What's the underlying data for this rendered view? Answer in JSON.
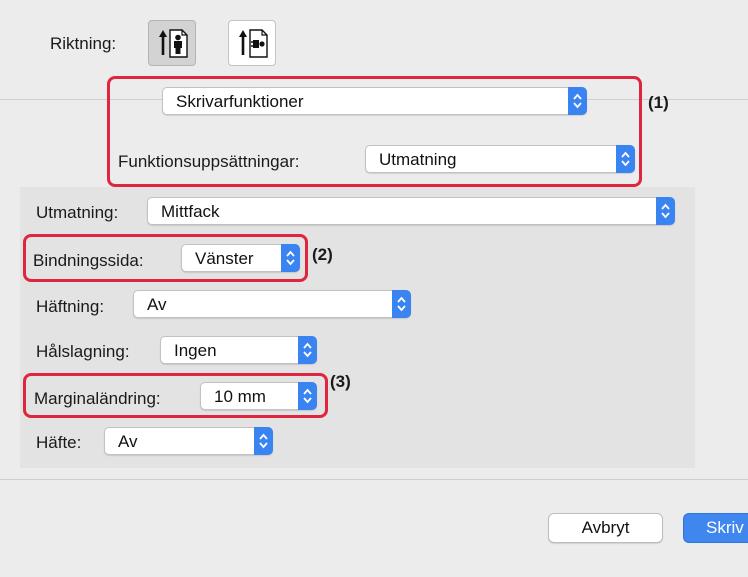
{
  "orientation": {
    "label": "Riktning:",
    "portrait_icon": "portrait-orientation-icon",
    "landscape_icon": "landscape-orientation-icon",
    "selected": "portrait"
  },
  "settings": {
    "category_value": "Skrivarfunktioner",
    "feature_set_label": "Funktionsuppsättningar:",
    "feature_set_value": "Utmatning"
  },
  "options": {
    "output_label": "Utmatning:",
    "output_value": "Mittfack",
    "binding_label": "Bindningssida:",
    "binding_value": "Vänster",
    "staple_label": "Häftning:",
    "staple_value": "Av",
    "punch_label": "Hålslagning:",
    "punch_value": "Ingen",
    "margin_label": "Marginaländring:",
    "margin_value": "10 mm",
    "booklet_label": "Häfte:",
    "booklet_value": "Av"
  },
  "callouts": {
    "c1": "(1)",
    "c2": "(2)",
    "c3": "(3)",
    "color": "#e0263f"
  },
  "buttons": {
    "cancel": "Avbryt",
    "print": "Skriv"
  },
  "colors": {
    "accent": "#3a84f1",
    "background": "#ececec"
  }
}
